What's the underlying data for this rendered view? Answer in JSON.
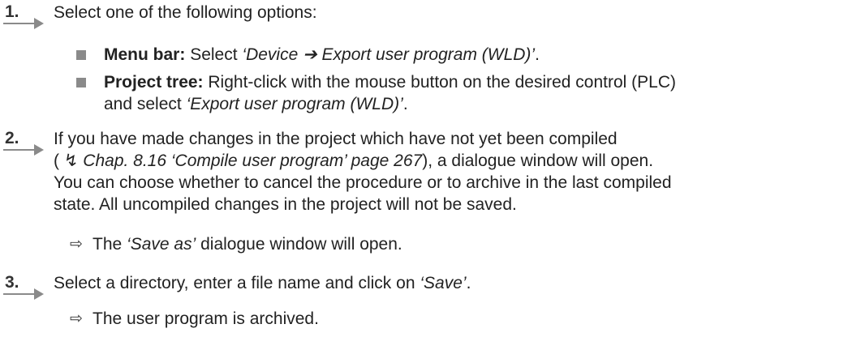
{
  "steps": [
    {
      "number": "1.",
      "text": "Select one of the following options:",
      "bullets": [
        {
          "label": "Menu bar:",
          "text": "Select",
          "italic": "‘Device ➔ Export user program (WLD)’",
          "after": "."
        },
        {
          "label": "Project tree:",
          "text": "Right-click with the mouse button on the desired control (PLC)",
          "line2": "and select",
          "italic": "‘Export user program (WLD)’",
          "after": "."
        }
      ]
    },
    {
      "number": "2.",
      "line1": "If you have made changes in the project which have not yet been compiled",
      "ref_open": "(",
      "ref_icon": "↯",
      "ref_italic": "Chap. 8.16 ‘Compile user program’ page 267",
      "ref_after": "), a dialogue window will open.",
      "line3": "You can choose whether to cancel the procedure or to archive in the last compiled",
      "line4": "state. All uncompiled changes in the project will not be saved.",
      "result_icon": "⇨",
      "result_pre": "The",
      "result_italic": "‘Save as’",
      "result_post": "dialogue window will open."
    },
    {
      "number": "3.",
      "text_pre": "Select a directory, enter a file name and click on",
      "text_italic": "‘Save’",
      "text_post": ".",
      "result_icon": "⇨",
      "result": "The user program is archived."
    }
  ]
}
